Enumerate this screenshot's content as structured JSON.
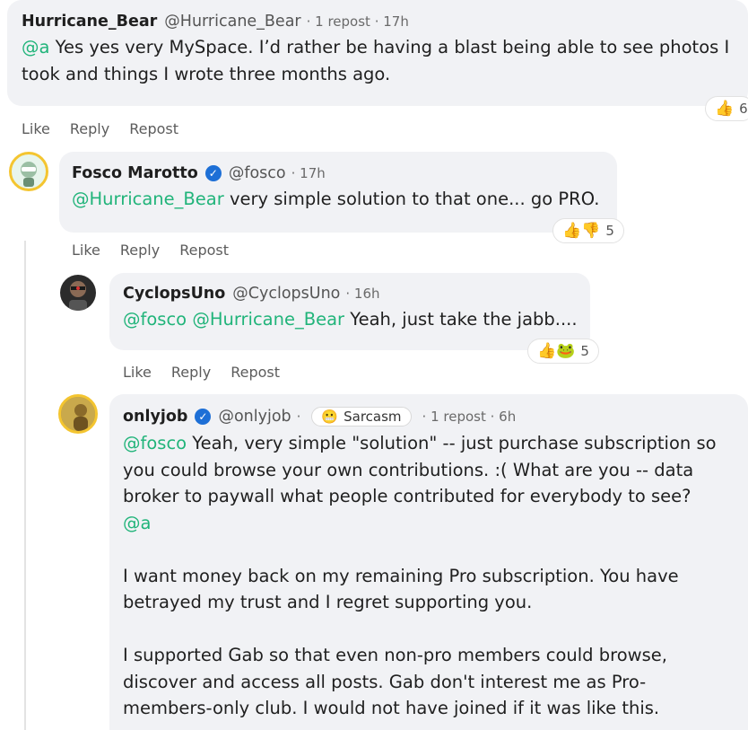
{
  "actions": {
    "like": "Like",
    "reply": "Reply",
    "repost": "Repost"
  },
  "comments": [
    {
      "name": "Hurricane_Bear",
      "handle": "@Hurricane_Bear",
      "meta": "· 1 repost · 17h",
      "mention": "@a",
      "text": " Yes yes very MySpace. I’d rather be having a blast being able to see photos I took and things I wrote three months ago.",
      "reactions": {
        "emoji": "👍",
        "count": "6"
      }
    },
    {
      "name": "Fosco Marotto",
      "handle": "@fosco",
      "meta": "· 17h",
      "mention": "@Hurricane_Bear",
      "text": " very simple solution to that one... go PRO.",
      "reactions": {
        "emoji": "👍👎",
        "count": "5"
      }
    },
    {
      "name": "CyclopsUno",
      "handle": "@CyclopsUno",
      "meta": "· 16h",
      "mention1": "@fosco",
      "mention2": "@Hurricane_Bear",
      "text": " Yeah, just take the jabb....",
      "reactions": {
        "emoji": "👍🐸",
        "count": "5"
      }
    },
    {
      "name": "onlyjob",
      "handle": "@onlyjob",
      "sep": "·",
      "tag": {
        "emoji": "😬",
        "label": "Sarcasm"
      },
      "meta": "· 1 repost · 6h",
      "mention1": "@fosco",
      "text1": " Yeah, very simple \"solution\" -- just purchase subscription so you could browse your own contributions. :( What are you -- data broker to paywall what people contributed for everybody to see?",
      "mention2": "@a",
      "para2": "I want money back on my remaining Pro subscription. You have betrayed my trust and I regret supporting you.",
      "para3": "I supported Gab so that even non-pro members could browse, discover and access all posts. Gab don't interest me as Pro-members-only club. I would not have joined if it was like this."
    }
  ]
}
